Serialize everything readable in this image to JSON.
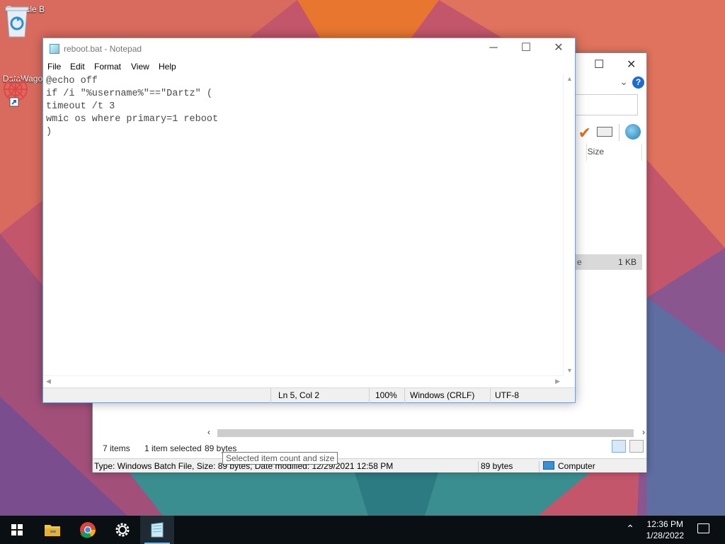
{
  "desktop": {
    "icons": [
      {
        "label": "Recycle B",
        "icon": "recycle-bin-icon"
      },
      {
        "label": "DataWago",
        "icon": "datawagon-shortcut-icon"
      }
    ]
  },
  "explorer": {
    "column_size": "Size",
    "selected_row_tail": "e",
    "selected_row_size": "1 KB",
    "status": {
      "items": "7 items",
      "selected": "1 item selected",
      "size": "89 bytes"
    },
    "bottom": {
      "details": "Type: Windows Batch File, Size: 89 bytes, Date modified: 12/29/2021 12:58 PM",
      "size": "89 bytes",
      "location": "Computer"
    },
    "tooltip": "Selected item count and size"
  },
  "notepad": {
    "title": "reboot.bat - Notepad",
    "menu": [
      "File",
      "Edit",
      "Format",
      "View",
      "Help"
    ],
    "content": "@echo off\nif /i \"%username%\"==\"Dartz\" (\ntimeout /t 3\nwmic os where primary=1 reboot\n)",
    "status": {
      "position": "Ln 5, Col 2",
      "zoom": "100%",
      "line_ending": "Windows (CRLF)",
      "encoding": "UTF-8"
    }
  },
  "taskbar": {
    "apps": [
      "start-icon",
      "file-explorer-icon",
      "chrome-icon",
      "settings-icon",
      "notepad-icon"
    ],
    "time": "12:36 PM",
    "date": "1/28/2022"
  }
}
